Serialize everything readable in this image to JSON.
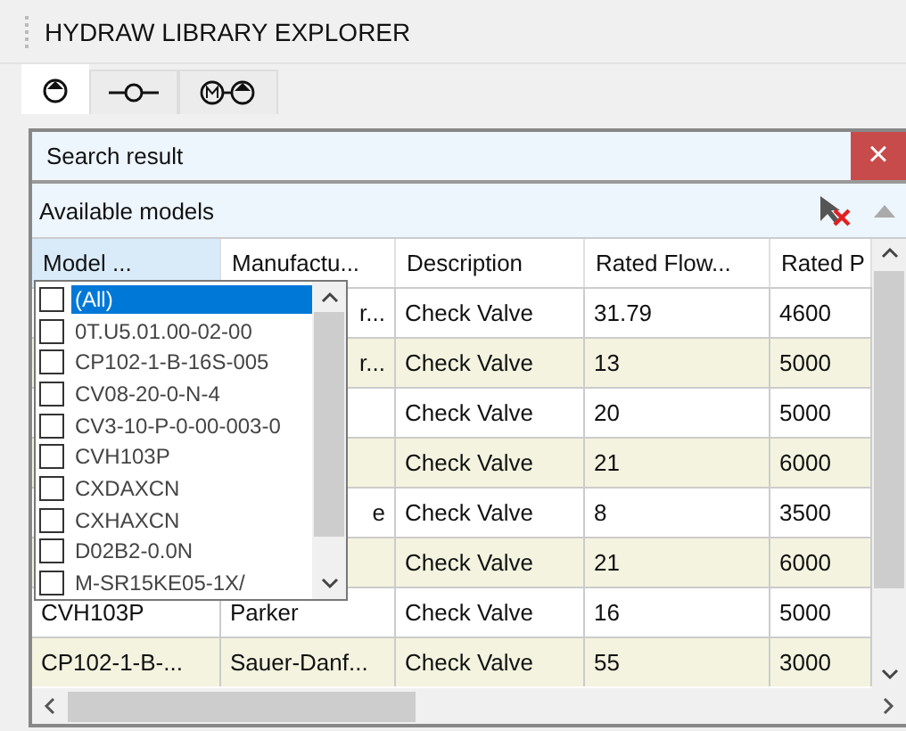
{
  "window": {
    "title": "HYDRAW LIBRARY EXPLORER"
  },
  "tabs": [
    {
      "kind": "pump",
      "selected": true
    },
    {
      "kind": "valve",
      "selected": false
    },
    {
      "kind": "motor-pump",
      "selected": false
    }
  ],
  "search_panel": {
    "title": "Search result",
    "close": "×"
  },
  "models_panel": {
    "title": "Available models"
  },
  "table": {
    "columns": [
      {
        "label": "Model ...",
        "selected": true
      },
      {
        "label": "Manufactu...",
        "selected": false
      },
      {
        "label": "Description",
        "selected": false
      },
      {
        "label": "Rated Flow...",
        "selected": false
      },
      {
        "label": "Rated P",
        "selected": false
      }
    ],
    "rows": [
      {
        "manufacturer": "r...",
        "description": "Check Valve",
        "rated_flow": "31.79",
        "rated_pressure": "4600"
      },
      {
        "manufacturer": "r...",
        "description": "Check Valve",
        "rated_flow": "13",
        "rated_pressure": "5000"
      },
      {
        "description": "Check Valve",
        "rated_flow": "20",
        "rated_pressure": "5000"
      },
      {
        "description": "Check Valve",
        "rated_flow": "21",
        "rated_pressure": "6000"
      },
      {
        "manufacturer": "e",
        "description": "Check Valve",
        "rated_flow": "8",
        "rated_pressure": "3500"
      },
      {
        "description": "Check Valve",
        "rated_flow": "21",
        "rated_pressure": "6000"
      },
      {
        "model": "CVH103P",
        "manufacturer": "Parker",
        "description": "Check Valve",
        "rated_flow": "16",
        "rated_pressure": "5000"
      },
      {
        "model": "CP102-1-B-...",
        "manufacturer": "Sauer-Danf...",
        "description": "Check Valve",
        "rated_flow": "55",
        "rated_pressure": "3000"
      }
    ]
  },
  "filter_dropdown": {
    "items": [
      {
        "label": "(All)",
        "checked": false,
        "selected": true
      },
      {
        "label": "0T.U5.01.00-02-00",
        "checked": false,
        "selected": false
      },
      {
        "label": "CP102-1-B-16S-005",
        "checked": false,
        "selected": false
      },
      {
        "label": "CV08-20-0-N-4",
        "checked": false,
        "selected": false
      },
      {
        "label": "CV3-10-P-0-00-003-0",
        "checked": false,
        "selected": false
      },
      {
        "label": "CVH103P",
        "checked": false,
        "selected": false
      },
      {
        "label": "CXDAXCN",
        "checked": false,
        "selected": false
      },
      {
        "label": "CXHAXCN",
        "checked": false,
        "selected": false
      },
      {
        "label": "D02B2-0.0N",
        "checked": false,
        "selected": false
      },
      {
        "label": "M-SR15KE05-1X/",
        "checked": false,
        "selected": false
      }
    ]
  }
}
